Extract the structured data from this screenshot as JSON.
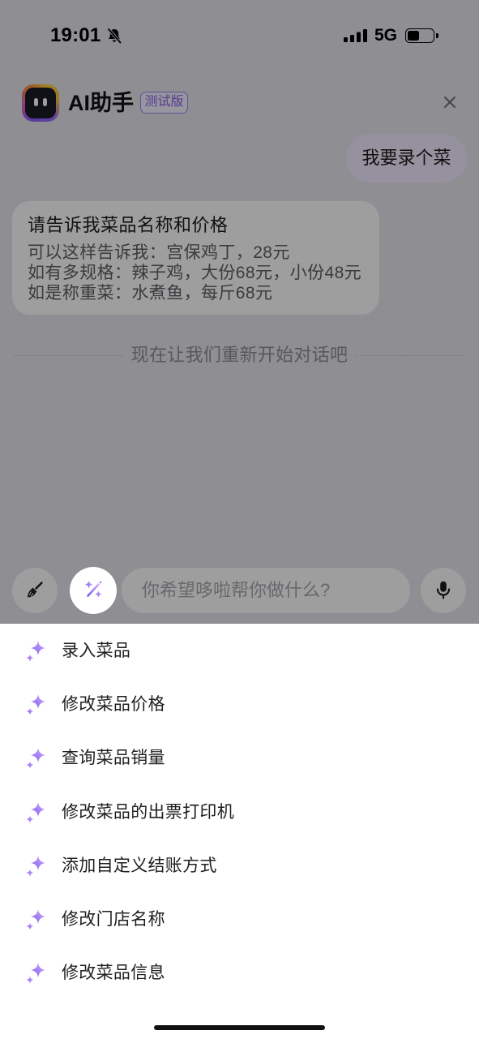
{
  "status_bar": {
    "time": "19:01",
    "network": "5G",
    "battery_level": 0.45,
    "icons": [
      "bell-slash-icon",
      "signal-icon",
      "battery-icon"
    ]
  },
  "header": {
    "title": "AI助手",
    "badge": "测试版",
    "icons": {
      "logo": "robot-face-logo",
      "close": "close-icon"
    }
  },
  "chat": {
    "user_message": "我要录个菜",
    "bot_message": {
      "title": "请告诉我菜品名称和价格",
      "lines": [
        "可以这样告诉我：宫保鸡丁，28元",
        "如有多规格：辣子鸡，大份68元，小份48元",
        "如是称重菜：水煮鱼，每斤68元"
      ]
    },
    "divider_text": "现在让我们重新开始对话吧"
  },
  "composer": {
    "placeholder": "你希望哆啦帮你做什么?",
    "icons": {
      "clear": "broom-icon",
      "skills": "magic-wand-icon",
      "voice": "microphone-icon"
    }
  },
  "quick_actions": {
    "icon": "sparkle-icon",
    "items": [
      {
        "label": "录入菜品"
      },
      {
        "label": "修改菜品价格"
      },
      {
        "label": "查询菜品销量"
      },
      {
        "label": "修改菜品的出票打印机"
      },
      {
        "label": "添加自定义结账方式"
      },
      {
        "label": "修改门店名称"
      },
      {
        "label": "修改菜品信息"
      }
    ]
  },
  "colors": {
    "accent": "#8e66ee",
    "page_background": "#e6e6ee",
    "user_bubble": "#f3ebff",
    "sheet_background": "#ffffff"
  }
}
